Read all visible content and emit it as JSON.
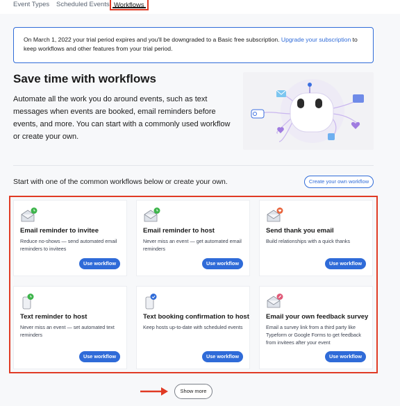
{
  "tabs": [
    {
      "label": "Event Types"
    },
    {
      "label": "Scheduled Events"
    },
    {
      "label": "Workflows"
    }
  ],
  "banner": {
    "text_before": "On March 1, 2022 your trial period expires and you'll be downgraded to a Basic free subscription. ",
    "link": "Upgrade your subscription",
    "text_after": " to keep workflows and other features from your trial period."
  },
  "hero": {
    "title": "Save time with workflows",
    "description": "Automate all the work you do around events, such as text messages when events are booked, email reminders before events, and more. You can start with a commonly used workflow or create your own."
  },
  "section": {
    "intro": "Start with one of the common workflows below or create your own.",
    "create_label": "Create your own workflow"
  },
  "cards": [
    {
      "icon": "email-clock-icon",
      "title": "Email reminder to invitee",
      "description": "Reduce no-shows — send automated email reminders to invitees",
      "button": "Use workflow"
    },
    {
      "icon": "email-clock-icon",
      "title": "Email reminder to host",
      "description": "Never miss an event — get automated email reminders",
      "button": "Use workflow"
    },
    {
      "icon": "email-heart-icon",
      "title": "Send thank you email",
      "description": "Build relationships with a quick thanks",
      "button": "Use workflow"
    },
    {
      "icon": "phone-clock-icon",
      "title": "Text reminder to host",
      "description": "Never miss an event — set automated text reminders",
      "button": "Use workflow"
    },
    {
      "icon": "phone-check-icon",
      "title": "Text booking confirmation to host",
      "description": "Keep hosts up-to-date with scheduled events",
      "button": "Use workflow"
    },
    {
      "icon": "email-pencil-icon",
      "title": "Email your own feedback survey",
      "description": "Email a survey link from a third party like Typeform or Google Forms to get feedback from invitees after your event",
      "button": "Use workflow"
    }
  ],
  "show_more": "Show more",
  "colors": {
    "accent": "#2f6bd8",
    "highlight_red": "#e03a24",
    "badge_green": "#3cb44a",
    "badge_orange": "#e8643c",
    "badge_blue": "#2f6bd8",
    "badge_pink": "#e05a78"
  }
}
